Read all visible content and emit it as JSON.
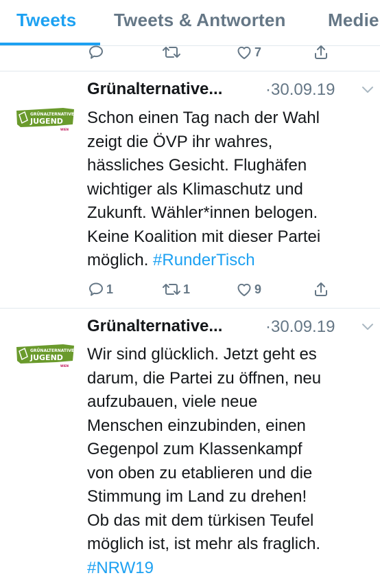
{
  "tabs": [
    {
      "label": "Tweets",
      "active": true
    },
    {
      "label": "Tweets & Antworten",
      "active": false
    },
    {
      "label": "Medien",
      "active": false
    }
  ],
  "colors": {
    "accent": "#1da1f2",
    "muted": "#657786",
    "text": "#14171a",
    "brand_green": "#6a9a2c",
    "brand_pink": "#c2185b"
  },
  "top_actions": {
    "replies": "",
    "retweets": "",
    "likes": "7"
  },
  "tweets": [
    {
      "author": "Grünalternative...",
      "date": "·30.09.19",
      "avatar_text": {
        "line1": "GRÜNALTERNATIVE",
        "line2": "JUGEND",
        "line3": "WIEN"
      },
      "lines": [
        "Schon einen Tag nach der Wahl",
        "zeigt die ÖVP ihr wahres,",
        "hässliches Gesicht. Flughäfen",
        "wichtiger als Klimaschutz und",
        "Zukunft. Wähler*innen belogen.",
        "Keine Koalition mit dieser Partei",
        "möglich. "
      ],
      "hashtag": "#RunderTisch",
      "replies": "1",
      "retweets": "1",
      "likes": "9"
    },
    {
      "author": "Grünalternative...",
      "date": "·30.09.19",
      "avatar_text": {
        "line1": "GRÜNALTERNATIVE",
        "line2": "JUGEND",
        "line3": "WIEN"
      },
      "lines": [
        "Wir sind glücklich. Jetzt geht es",
        "darum, die Partei zu öffnen, neu",
        "aufzubauen, viele neue",
        "Menschen einzubinden, einen",
        "Gegenpol zum Klassenkampf",
        "von oben zu etablieren und die",
        "Stimmung im Land zu drehen!",
        "Ob das mit dem türkisen Teufel",
        "möglich ist, ist mehr als fraglich."
      ],
      "hashtag": "#NRW19"
    }
  ]
}
